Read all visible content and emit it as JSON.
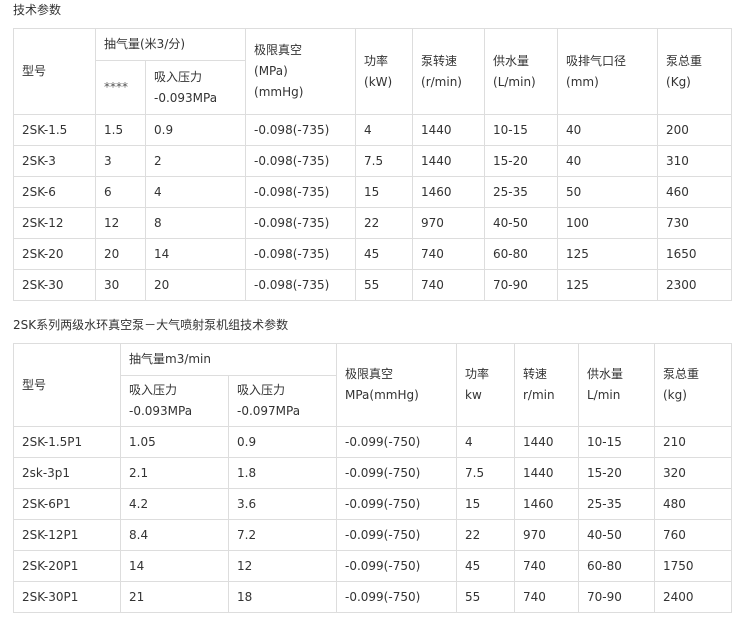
{
  "section1": {
    "title": "技术参数",
    "headers": {
      "model": "型号",
      "suction_group": "抽气量(米3/分)",
      "sub_a": "****",
      "sub_b_line1": "吸入压力",
      "sub_b_line2": "-0.093MPa",
      "vacuum_line1": "极限真空",
      "vacuum_line2": "(MPa)",
      "vacuum_line3": "(mmHg)",
      "power_line1": "功率",
      "power_line2": "(kW)",
      "speed_line1": "泵转速",
      "speed_line2": "(r/min)",
      "water_line1": "供水量",
      "water_line2": "(L/min)",
      "port_line1": "吸排气口径",
      "port_line2": "(mm)",
      "weight_line1": "泵总重",
      "weight_line2": "(Kg)"
    },
    "rows": [
      [
        "2SK-1.5",
        "1.5",
        "0.9",
        "-0.098(-735)",
        "4",
        "1440",
        "10-15",
        "40",
        "200"
      ],
      [
        "2SK-3",
        "3",
        "2",
        "-0.098(-735)",
        "7.5",
        "1440",
        "15-20",
        "40",
        "310"
      ],
      [
        "2SK-6",
        "6",
        "4",
        "-0.098(-735)",
        "15",
        "1460",
        "25-35",
        "50",
        "460"
      ],
      [
        "2SK-12",
        "12",
        "8",
        "-0.098(-735)",
        "22",
        "970",
        "40-50",
        "100",
        "730"
      ],
      [
        "2SK-20",
        "20",
        "14",
        "-0.098(-735)",
        "45",
        "740",
        "60-80",
        "125",
        "1650"
      ],
      [
        "2SK-30",
        "30",
        "20",
        "-0.098(-735)",
        "55",
        "740",
        "70-90",
        "125",
        "2300"
      ]
    ]
  },
  "section2": {
    "title": "2SK系列两级水环真空泵－大气喷射泵机组技术参数",
    "headers": {
      "model": "型号",
      "suction_group": "抽气量m3/min",
      "sub_a_line1": "吸入压力",
      "sub_a_line2": "-0.093MPa",
      "sub_b_line1": "吸入压力",
      "sub_b_line2": "-0.097MPa",
      "vacuum_line1": "极限真空",
      "vacuum_line2": "MPa(mmHg)",
      "power_line1": "功率",
      "power_line2": "kw",
      "speed_line1": "转速",
      "speed_line2": "r/min",
      "water_line1": "供水量",
      "water_line2": "L/min",
      "weight_line1": "泵总重",
      "weight_line2": "(kg)"
    },
    "rows": [
      [
        "2SK-1.5P1",
        "1.05",
        "0.9",
        "-0.099(-750)",
        "4",
        "1440",
        "10-15",
        "210"
      ],
      [
        "2sk-3p1",
        "2.1",
        "1.8",
        "-0.099(-750)",
        "7.5",
        "1440",
        "15-20",
        "320"
      ],
      [
        "2SK-6P1",
        "4.2",
        "3.6",
        "-0.099(-750)",
        "15",
        "1460",
        "25-35",
        "480"
      ],
      [
        "2SK-12P1",
        "8.4",
        "7.2",
        "-0.099(-750)",
        "22",
        "970",
        "40-50",
        "760"
      ],
      [
        "2SK-20P1",
        "14",
        "12",
        "-0.099(-750)",
        "45",
        "740",
        "60-80",
        "1750"
      ],
      [
        "2SK-30P1",
        "21",
        "18",
        "-0.099(-750)",
        "55",
        "740",
        "70-90",
        "2400"
      ]
    ]
  }
}
